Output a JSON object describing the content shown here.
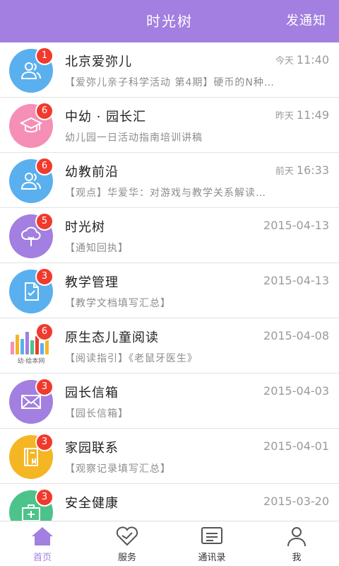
{
  "header": {
    "title": "时光树",
    "action": "发通知"
  },
  "conversations": [
    {
      "title": "北京爱弥儿",
      "time_rel": "今天",
      "time": "11:40",
      "subtitle": "【爱弥儿亲子科学活动 第4期】硬币的N种…",
      "badge": "1",
      "avatar_color": "#5ab0ee",
      "icon": "people-icon"
    },
    {
      "title": "中幼 · 园长汇",
      "time_rel": "昨天",
      "time": "11:49",
      "subtitle": "幼儿园一日活动指南培训讲稿",
      "badge": "6",
      "avatar_color": "#f58fb6",
      "icon": "graduation-cap-icon"
    },
    {
      "title": "幼教前沿",
      "time_rel": "前天",
      "time": "16:33",
      "subtitle": "【观点】华爱华：对游戏与教学关系解读…",
      "badge": "6",
      "avatar_color": "#5ab0ee",
      "icon": "people-icon"
    },
    {
      "title": "时光树",
      "time_rel": "",
      "time": "2015-04-13",
      "subtitle": "【通知回执】",
      "badge": "5",
      "avatar_color": "#a27fe0",
      "icon": "tree-icon"
    },
    {
      "title": "教学管理",
      "time_rel": "",
      "time": "2015-04-13",
      "subtitle": "【教学文档填写汇总】",
      "badge": "3",
      "avatar_color": "#5ab0ee",
      "icon": "document-check-icon"
    },
    {
      "title": "原生态儿童阅读",
      "time_rel": "",
      "time": "2015-04-08",
      "subtitle": "【阅读指引】《老鼠牙医生》",
      "badge": "6",
      "avatar_color": "#ffffff",
      "icon": "picture-book-logo",
      "logo_caption": "幼·绘本网"
    },
    {
      "title": "园长信箱",
      "time_rel": "",
      "time": "2015-04-03",
      "subtitle": "【园长信箱】",
      "badge": "3",
      "avatar_color": "#a27fe0",
      "icon": "envelope-icon"
    },
    {
      "title": "家园联系",
      "time_rel": "",
      "time": "2015-04-01",
      "subtitle": "【观察记录填写汇总】",
      "badge": "3",
      "avatar_color": "#f5b623",
      "icon": "notebook-icon"
    },
    {
      "title": "安全健康",
      "time_rel": "",
      "time": "2015-03-20",
      "subtitle": "",
      "badge": "3",
      "avatar_color": "#4cc38a",
      "icon": "first-aid-kit-icon"
    }
  ],
  "tabs": [
    {
      "label": "首页",
      "icon": "home-icon",
      "active": true
    },
    {
      "label": "服务",
      "icon": "heart-icon",
      "active": false
    },
    {
      "label": "通讯录",
      "icon": "contacts-icon",
      "active": false
    },
    {
      "label": "我",
      "icon": "person-icon",
      "active": false
    }
  ],
  "colors": {
    "accent": "#a27fe0",
    "badge": "#f03a2d"
  }
}
